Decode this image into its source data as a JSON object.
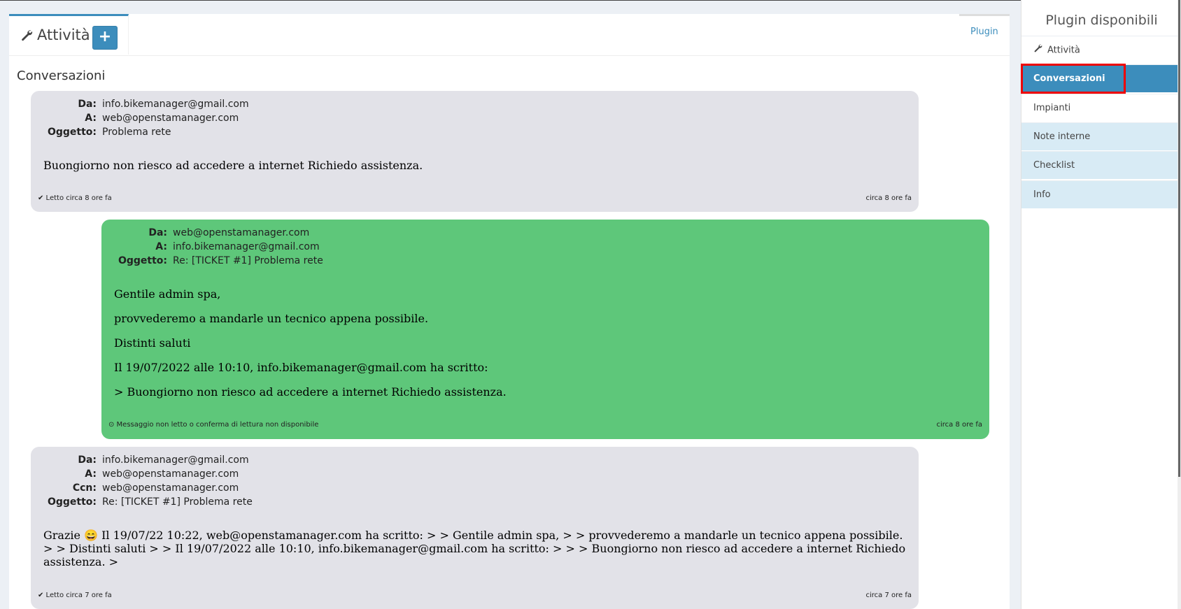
{
  "tabs": {
    "active_label": "Attività",
    "add_symbol": "+",
    "plugin_label": "Plugin"
  },
  "section_title": "Conversazioni",
  "messages": [
    {
      "direction": "in",
      "headers": [
        {
          "key": "Da:",
          "value": "info.bikemanager@gmail.com"
        },
        {
          "key": "A:",
          "value": "web@openstamanager.com"
        },
        {
          "key": "Oggetto:",
          "value": "Problema rete"
        }
      ],
      "body": [
        "Buongiorno non riesco ad accedere a internet Richiedo assistenza."
      ],
      "status": "✔ Letto circa 8 ore fa",
      "time": "circa 8 ore fa"
    },
    {
      "direction": "out",
      "headers": [
        {
          "key": "Da:",
          "value": "web@openstamanager.com"
        },
        {
          "key": "A:",
          "value": "info.bikemanager@gmail.com"
        },
        {
          "key": "Oggetto:",
          "value": "Re: [TICKET #1] Problema rete"
        }
      ],
      "body": [
        "Gentile admin spa,",
        "provvederemo a mandarle un tecnico appena possibile.",
        "Distinti saluti",
        "Il 19/07/2022 alle 10:10, info.bikemanager@gmail.com ha scritto:",
        "> Buongiorno non riesco ad accedere a internet Richiedo assistenza."
      ],
      "status": "⊙ Messaggio non letto o conferma di lettura non disponibile",
      "time": "circa 8 ore fa"
    },
    {
      "direction": "in",
      "headers": [
        {
          "key": "Da:",
          "value": "info.bikemanager@gmail.com"
        },
        {
          "key": "A:",
          "value": "web@openstamanager.com"
        },
        {
          "key": "Ccn:",
          "value": "web@openstamanager.com"
        },
        {
          "key": "Oggetto:",
          "value": "Re: [TICKET #1] Problema rete"
        }
      ],
      "body": [
        "Grazie 😄 Il 19/07/22 10:22, web@openstamanager.com ha scritto: > > Gentile admin spa, > > provvederemo a mandarle un tecnico appena possibile.",
        "> > Distinti saluti > > Il 19/07/2022 alle 10:10, info.bikemanager@gmail.com ha scritto: > > > Buongiorno non riesco ad accedere a internet Richiedo",
        "assistenza. >"
      ],
      "status": "✔ Letto circa 7 ore fa",
      "time": "circa 7 ore fa"
    }
  ],
  "sidebar": {
    "title": "Plugin disponibili",
    "items": [
      {
        "label": "Attività",
        "icon": "wrench-icon",
        "state": "normal"
      },
      {
        "label": "Conversazioni",
        "state": "active"
      },
      {
        "label": "Impianti",
        "state": "normal"
      },
      {
        "label": "Note interne",
        "state": "light"
      },
      {
        "label": "Checklist",
        "state": "light"
      },
      {
        "label": "Info",
        "state": "light"
      }
    ]
  },
  "colors": {
    "accent": "#3c8dbc",
    "incoming_bg": "#e2e2e8",
    "outgoing_bg": "#5ec77a",
    "highlight": "#e00000"
  }
}
